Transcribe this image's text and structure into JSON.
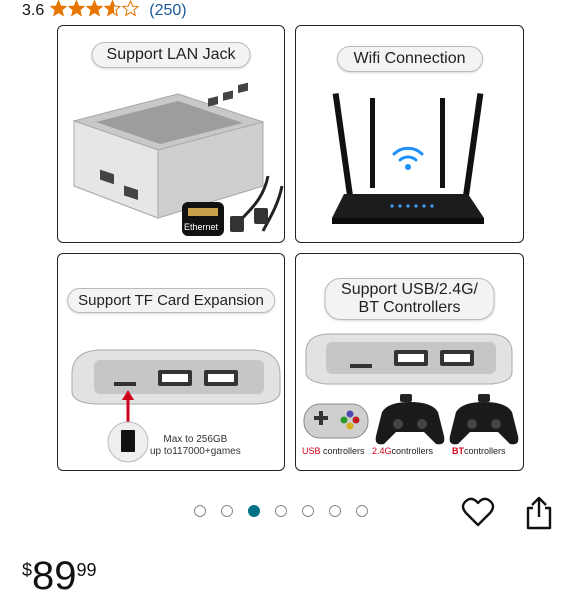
{
  "rating": {
    "value": "3.6",
    "stars": 3.6,
    "count": "(250)",
    "star_color": "#e77600"
  },
  "gallery": {
    "panels": [
      {
        "title": "Support LAN Jack",
        "port_label": "Ethernet"
      },
      {
        "title": "Wifi Connection"
      },
      {
        "title": "Support TF Card Expansion",
        "caption_line1": "Max to 256GB",
        "caption_line2": "up to117000+games"
      },
      {
        "title_line1": "Support USB/2.4G/",
        "title_line2": "BT Controllers",
        "controller_labels": [
          {
            "prefix": "USB",
            "suffix": " controllers"
          },
          {
            "prefix": "2.4G",
            "suffix": "controllers"
          },
          {
            "prefix": "BT",
            "suffix": "controllers"
          }
        ]
      }
    ],
    "total_images": 7,
    "active_index": 2
  },
  "actions": {
    "favorite_icon": "heart-icon",
    "share_icon": "share-icon"
  },
  "price": {
    "currency": "$",
    "whole": "89",
    "fraction": "99"
  },
  "colors": {
    "accent": "#007185",
    "link": "#1a5a96",
    "highlight_red": "#d0021b"
  }
}
